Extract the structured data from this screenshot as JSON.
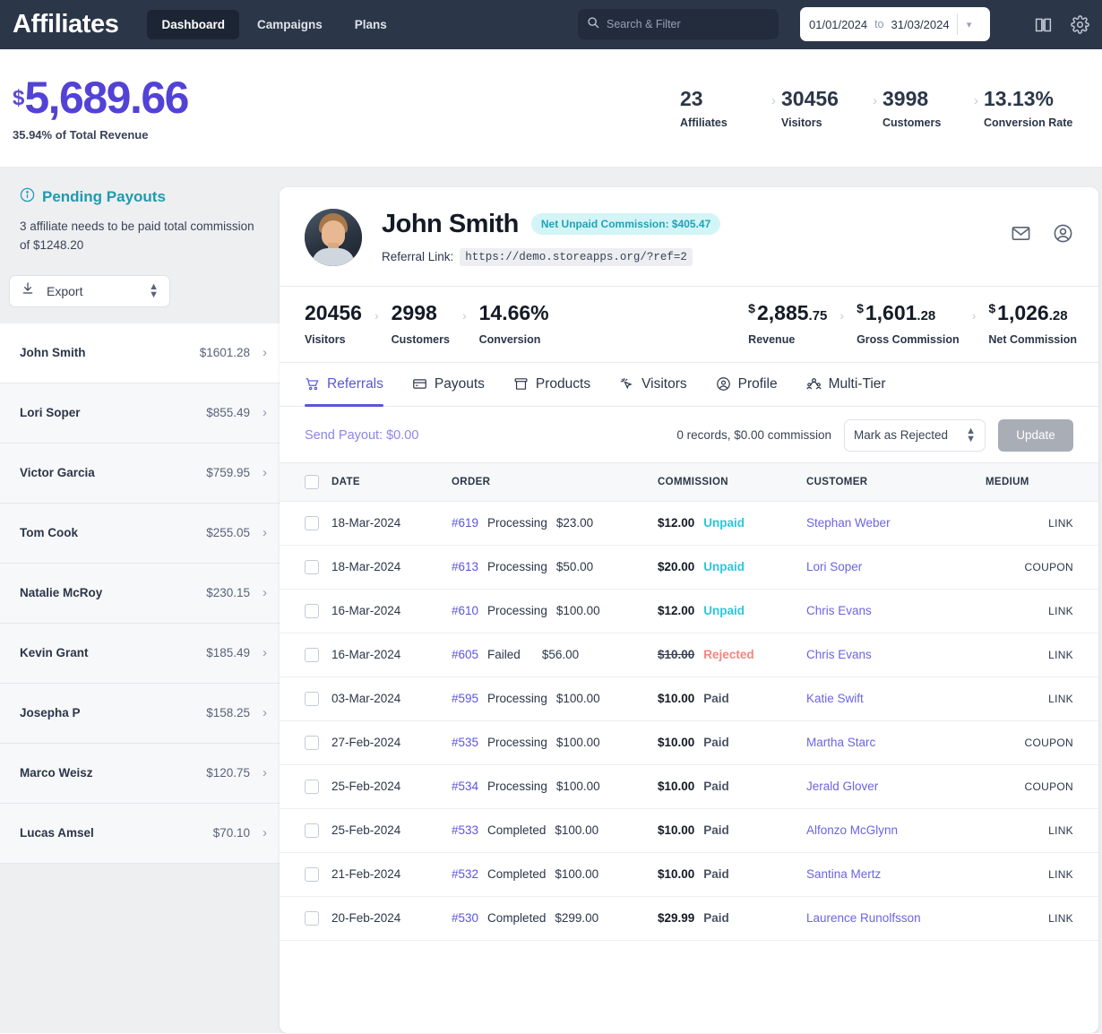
{
  "topnav": {
    "brand": "Affiliates",
    "links": [
      {
        "label": "Dashboard",
        "active": true
      },
      {
        "label": "Campaigns",
        "active": false
      },
      {
        "label": "Plans",
        "active": false
      }
    ],
    "search_placeholder": "Search & Filter",
    "date_from": "01/01/2024",
    "date_to_label": "to",
    "date_to": "31/03/2024",
    "icons": [
      "book-icon",
      "gear-icon"
    ],
    "colors": {
      "bg": "#2b3648",
      "active_bg": "#1c2534"
    }
  },
  "kpi": {
    "currency": "$",
    "revenue": "5,689.66",
    "revenue_sub": "35.94% of Total Revenue",
    "accent": "#5242d6",
    "items": [
      {
        "value": "23",
        "label": "Affiliates"
      },
      {
        "value": "30456",
        "label": "Visitors"
      },
      {
        "value": "3998",
        "label": "Customers"
      },
      {
        "value": "13.13%",
        "label": "Conversion Rate"
      }
    ]
  },
  "sidebar": {
    "info_icon": "info-circle-icon",
    "title": "Pending Payouts",
    "description": "3 affiliate needs to be paid total commission of $1248.20",
    "export_label": "Export",
    "export_icon": "download-icon",
    "affiliates": [
      {
        "name": "John Smith",
        "amount": "$1601.28",
        "selected": true
      },
      {
        "name": "Lori Soper",
        "amount": "$855.49",
        "selected": false
      },
      {
        "name": "Victor Garcia",
        "amount": "$759.95",
        "selected": false
      },
      {
        "name": "Tom Cook",
        "amount": "$255.05",
        "selected": false
      },
      {
        "name": "Natalie McRoy",
        "amount": "$230.15",
        "selected": false
      },
      {
        "name": "Kevin Grant",
        "amount": "$185.49",
        "selected": false
      },
      {
        "name": "Josepha P",
        "amount": "$158.25",
        "selected": false
      },
      {
        "name": "Marco Weisz",
        "amount": "$120.75",
        "selected": false
      },
      {
        "name": "Lucas Amsel",
        "amount": "$70.10",
        "selected": false
      }
    ]
  },
  "profile": {
    "name": "John Smith",
    "badge": "Net Unpaid Commission: $405.47",
    "badge_color": "#1fa3b5",
    "badge_bg": "#d4f5f7",
    "referral_label": "Referral Link:",
    "referral_url": "https://demo.storeapps.org/?ref=2",
    "actions": [
      "mail-icon",
      "user-circle-icon"
    ],
    "stats_left": [
      {
        "value": "20456",
        "label": "Visitors"
      },
      {
        "value": "2998",
        "label": "Customers"
      },
      {
        "value": "14.66%",
        "label": "Conversion"
      }
    ],
    "stats_right": [
      {
        "currency": "$",
        "value": "2,885",
        "cents": ".75",
        "label": "Revenue"
      },
      {
        "currency": "$",
        "value": "1,601",
        "cents": ".28",
        "label": "Gross Commission"
      },
      {
        "currency": "$",
        "value": "1,026",
        "cents": ".28",
        "label": "Net Commission"
      }
    ]
  },
  "tabs": [
    {
      "label": "Referrals",
      "icon": "cart-icon",
      "active": true
    },
    {
      "label": "Payouts",
      "icon": "card-icon",
      "active": false
    },
    {
      "label": "Products",
      "icon": "box-icon",
      "active": false
    },
    {
      "label": "Visitors",
      "icon": "cursor-click-icon",
      "active": false
    },
    {
      "label": "Profile",
      "icon": "user-circle-icon",
      "active": false
    },
    {
      "label": "Multi-Tier",
      "icon": "people-icon",
      "active": false
    }
  ],
  "toolbar": {
    "send_payout": "Send Payout: $0.00",
    "records": "0 records, $0.00 commission",
    "bulk_action": "Mark as Rejected",
    "update_label": "Update"
  },
  "table": {
    "columns": [
      "DATE",
      "ORDER",
      "COMMISSION",
      "CUSTOMER",
      "MEDIUM"
    ],
    "rows": [
      {
        "date": "18-Mar-2024",
        "order_id": "#619",
        "order_status": "Processing",
        "order_amount": "$23.00",
        "commission": "$12.00",
        "status": "Unpaid",
        "customer": "Stephan Weber",
        "medium": "LINK"
      },
      {
        "date": "18-Mar-2024",
        "order_id": "#613",
        "order_status": "Processing",
        "order_amount": "$50.00",
        "commission": "$20.00",
        "status": "Unpaid",
        "customer": "Lori Soper",
        "medium": "COUPON"
      },
      {
        "date": "16-Mar-2024",
        "order_id": "#610",
        "order_status": "Processing",
        "order_amount": "$100.00",
        "commission": "$12.00",
        "status": "Unpaid",
        "customer": "Chris Evans",
        "medium": "LINK"
      },
      {
        "date": "16-Mar-2024",
        "order_id": "#605",
        "order_status": "Failed",
        "order_amount": "$56.00",
        "commission": "$10.00",
        "status": "Rejected",
        "customer": "Chris Evans",
        "medium": "LINK"
      },
      {
        "date": "03-Mar-2024",
        "order_id": "#595",
        "order_status": "Processing",
        "order_amount": "$100.00",
        "commission": "$10.00",
        "status": "Paid",
        "customer": "Katie Swift",
        "medium": "LINK"
      },
      {
        "date": "27-Feb-2024",
        "order_id": "#535",
        "order_status": "Processing",
        "order_amount": "$100.00",
        "commission": "$10.00",
        "status": "Paid",
        "customer": "Martha Starc",
        "medium": "COUPON"
      },
      {
        "date": "25-Feb-2024",
        "order_id": "#534",
        "order_status": "Processing",
        "order_amount": "$100.00",
        "commission": "$10.00",
        "status": "Paid",
        "customer": "Jerald Glover",
        "medium": "COUPON"
      },
      {
        "date": "25-Feb-2024",
        "order_id": "#533",
        "order_status": "Completed",
        "order_amount": "$100.00",
        "commission": "$10.00",
        "status": "Paid",
        "customer": "Alfonzo McGlynn",
        "medium": "LINK"
      },
      {
        "date": "21-Feb-2024",
        "order_id": "#532",
        "order_status": "Completed",
        "order_amount": "$100.00",
        "commission": "$10.00",
        "status": "Paid",
        "customer": "Santina Mertz",
        "medium": "LINK"
      },
      {
        "date": "20-Feb-2024",
        "order_id": "#530",
        "order_status": "Completed",
        "order_amount": "$299.00",
        "commission": "$29.99",
        "status": "Paid",
        "customer": "Laurence Runolfsson",
        "medium": "LINK"
      }
    ]
  }
}
